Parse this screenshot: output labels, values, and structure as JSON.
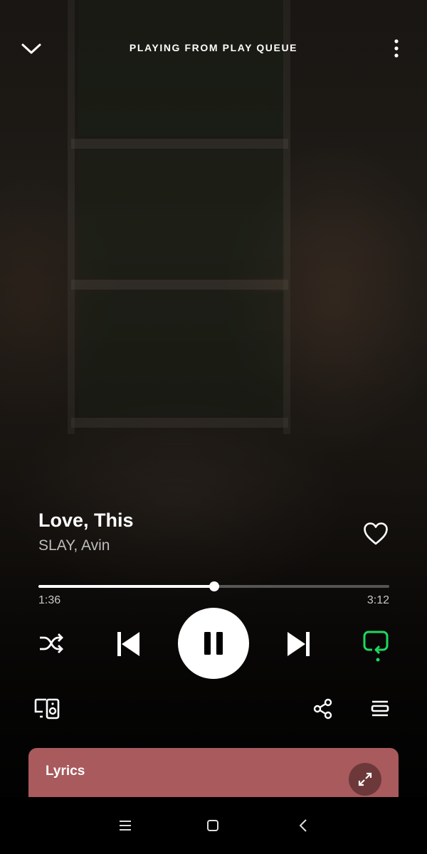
{
  "header": {
    "title": "PLAYING FROM PLAY QUEUE"
  },
  "track": {
    "title": "Love, This",
    "artist": "SLAY, Avin",
    "liked": false
  },
  "progress": {
    "elapsed": "1:36",
    "duration": "3:12",
    "fraction": 0.5
  },
  "controls": {
    "shuffle": "shuffle-icon",
    "previous": "skip-previous-icon",
    "play_state": "playing",
    "next": "skip-next-icon",
    "repeat": "repeat-one-icon",
    "repeat_active_color": "#1ed760"
  },
  "actions": {
    "devices": "connect-device-icon",
    "share": "share-icon",
    "queue": "queue-icon"
  },
  "lyrics": {
    "label": "Lyrics",
    "card_color": "#a85a5d"
  },
  "system_nav": [
    "menu-icon",
    "home-icon",
    "back-icon"
  ]
}
